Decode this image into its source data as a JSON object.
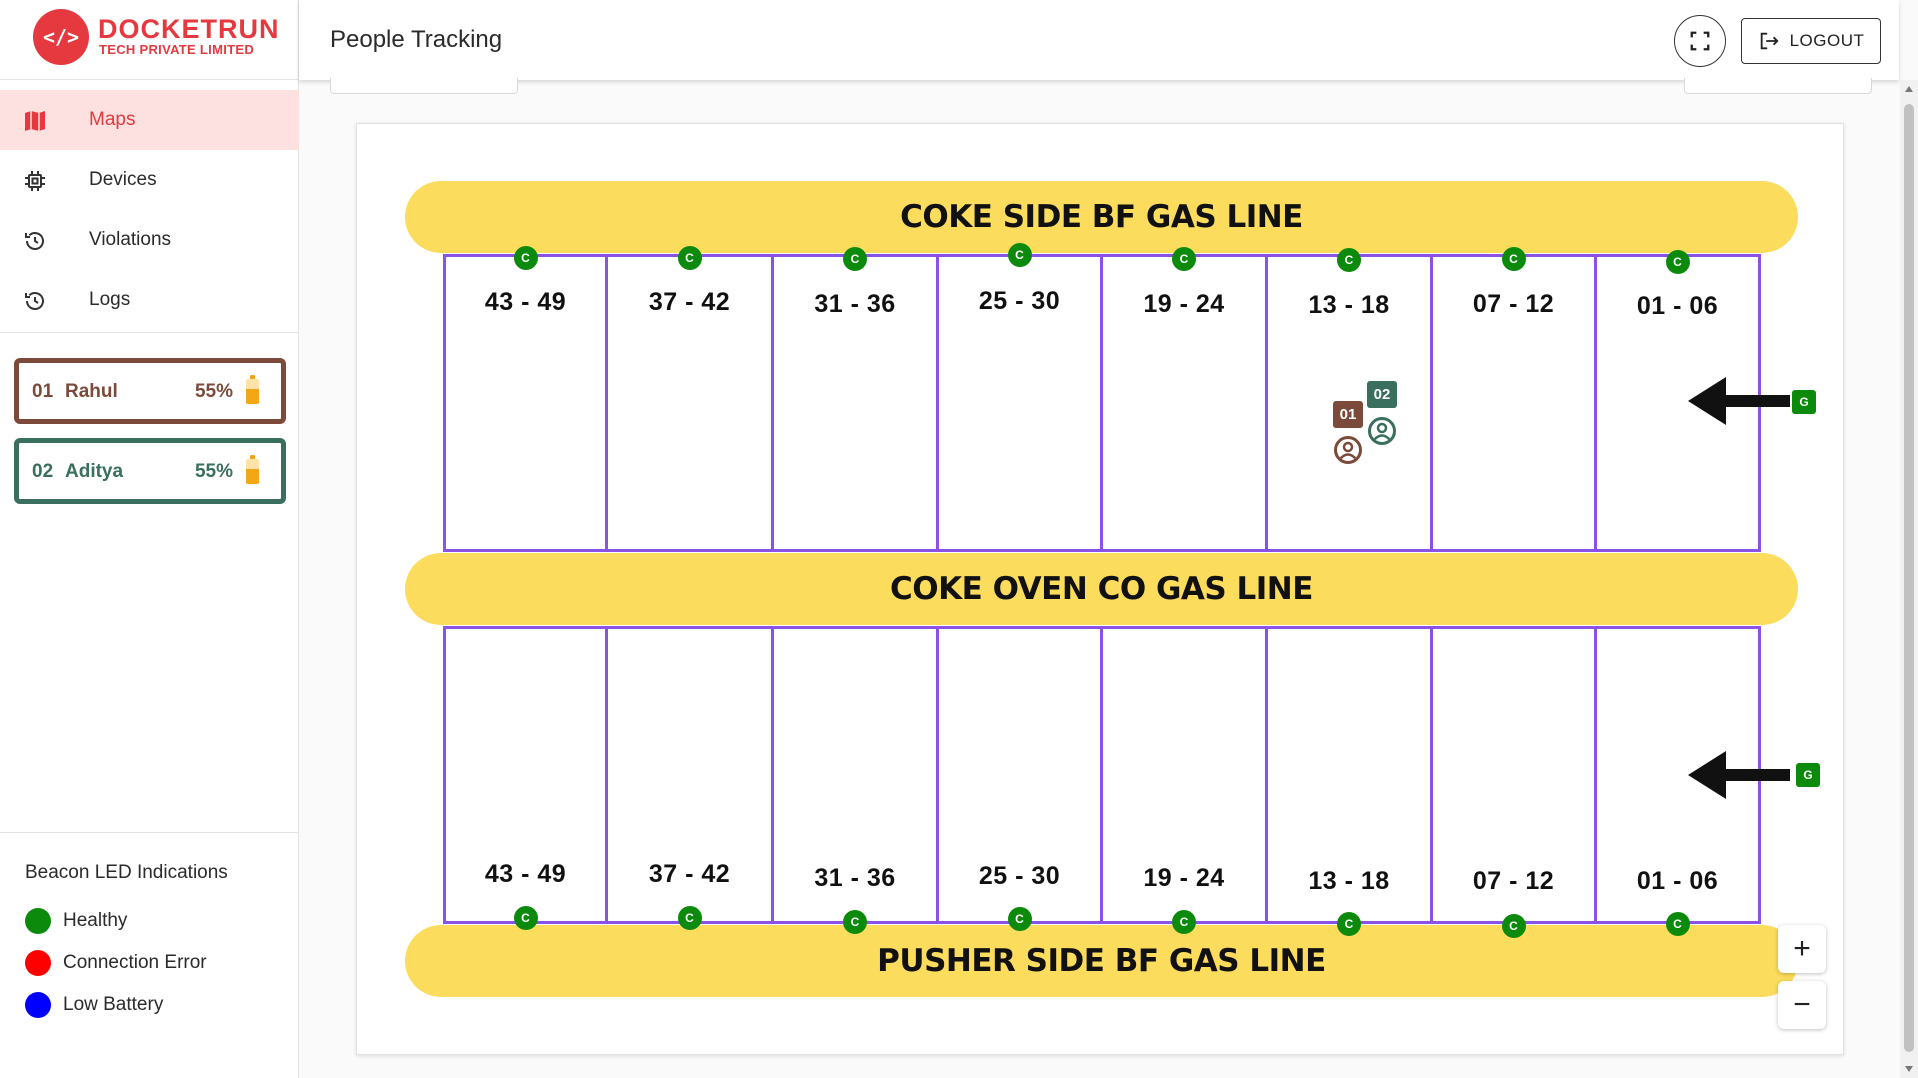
{
  "brand": {
    "logo_mark": "</>",
    "name": "DOCKETRUN",
    "subtitle": "TECH PRIVATE LIMITED",
    "color": "#e5393f"
  },
  "sidebar": {
    "items": [
      {
        "label": "Maps",
        "icon": "map-icon",
        "active": true
      },
      {
        "label": "Devices",
        "icon": "chip-icon",
        "active": false
      },
      {
        "label": "Violations",
        "icon": "history-icon",
        "active": false
      },
      {
        "label": "Logs",
        "icon": "history-icon",
        "active": false
      }
    ]
  },
  "people": [
    {
      "id": "01",
      "name": "Rahul",
      "battery": "55%",
      "color": "#7b4a3a"
    },
    {
      "id": "02",
      "name": "Aditya",
      "battery": "55%",
      "color": "#3a6e5e"
    }
  ],
  "legend": {
    "title": "Beacon LED Indications",
    "items": [
      {
        "label": "Healthy",
        "color": "#0c8a0c"
      },
      {
        "label": "Connection Error",
        "color": "#ff0000"
      },
      {
        "label": "Low Battery",
        "color": "#0000ff"
      }
    ]
  },
  "header": {
    "title": "People Tracking",
    "logout_label": "LOGOUT"
  },
  "map": {
    "gas_lines": {
      "top": "COKE SIDE BF GAS LINE",
      "middle": "COKE OVEN CO GAS LINE",
      "bottom": "PUSHER SIDE BF GAS LINE"
    },
    "bays": [
      "43 - 49",
      "37 - 42",
      "31 - 36",
      "25 - 30",
      "19 - 24",
      "13 - 18",
      "07 - 12",
      "01 - 06"
    ],
    "beacon_label": "C",
    "gateway_label": "G",
    "beacon_color": "#0c8a0c",
    "bay_border_color": "#8a52e6",
    "gas_line_color": "#fcdc5c",
    "tags": [
      {
        "id": "01",
        "color": "#7b4a3a",
        "bay": "13 - 18"
      },
      {
        "id": "02",
        "color": "#3a6e5e",
        "bay": "13 - 18"
      }
    ],
    "zoom_in": "+",
    "zoom_out": "−"
  }
}
